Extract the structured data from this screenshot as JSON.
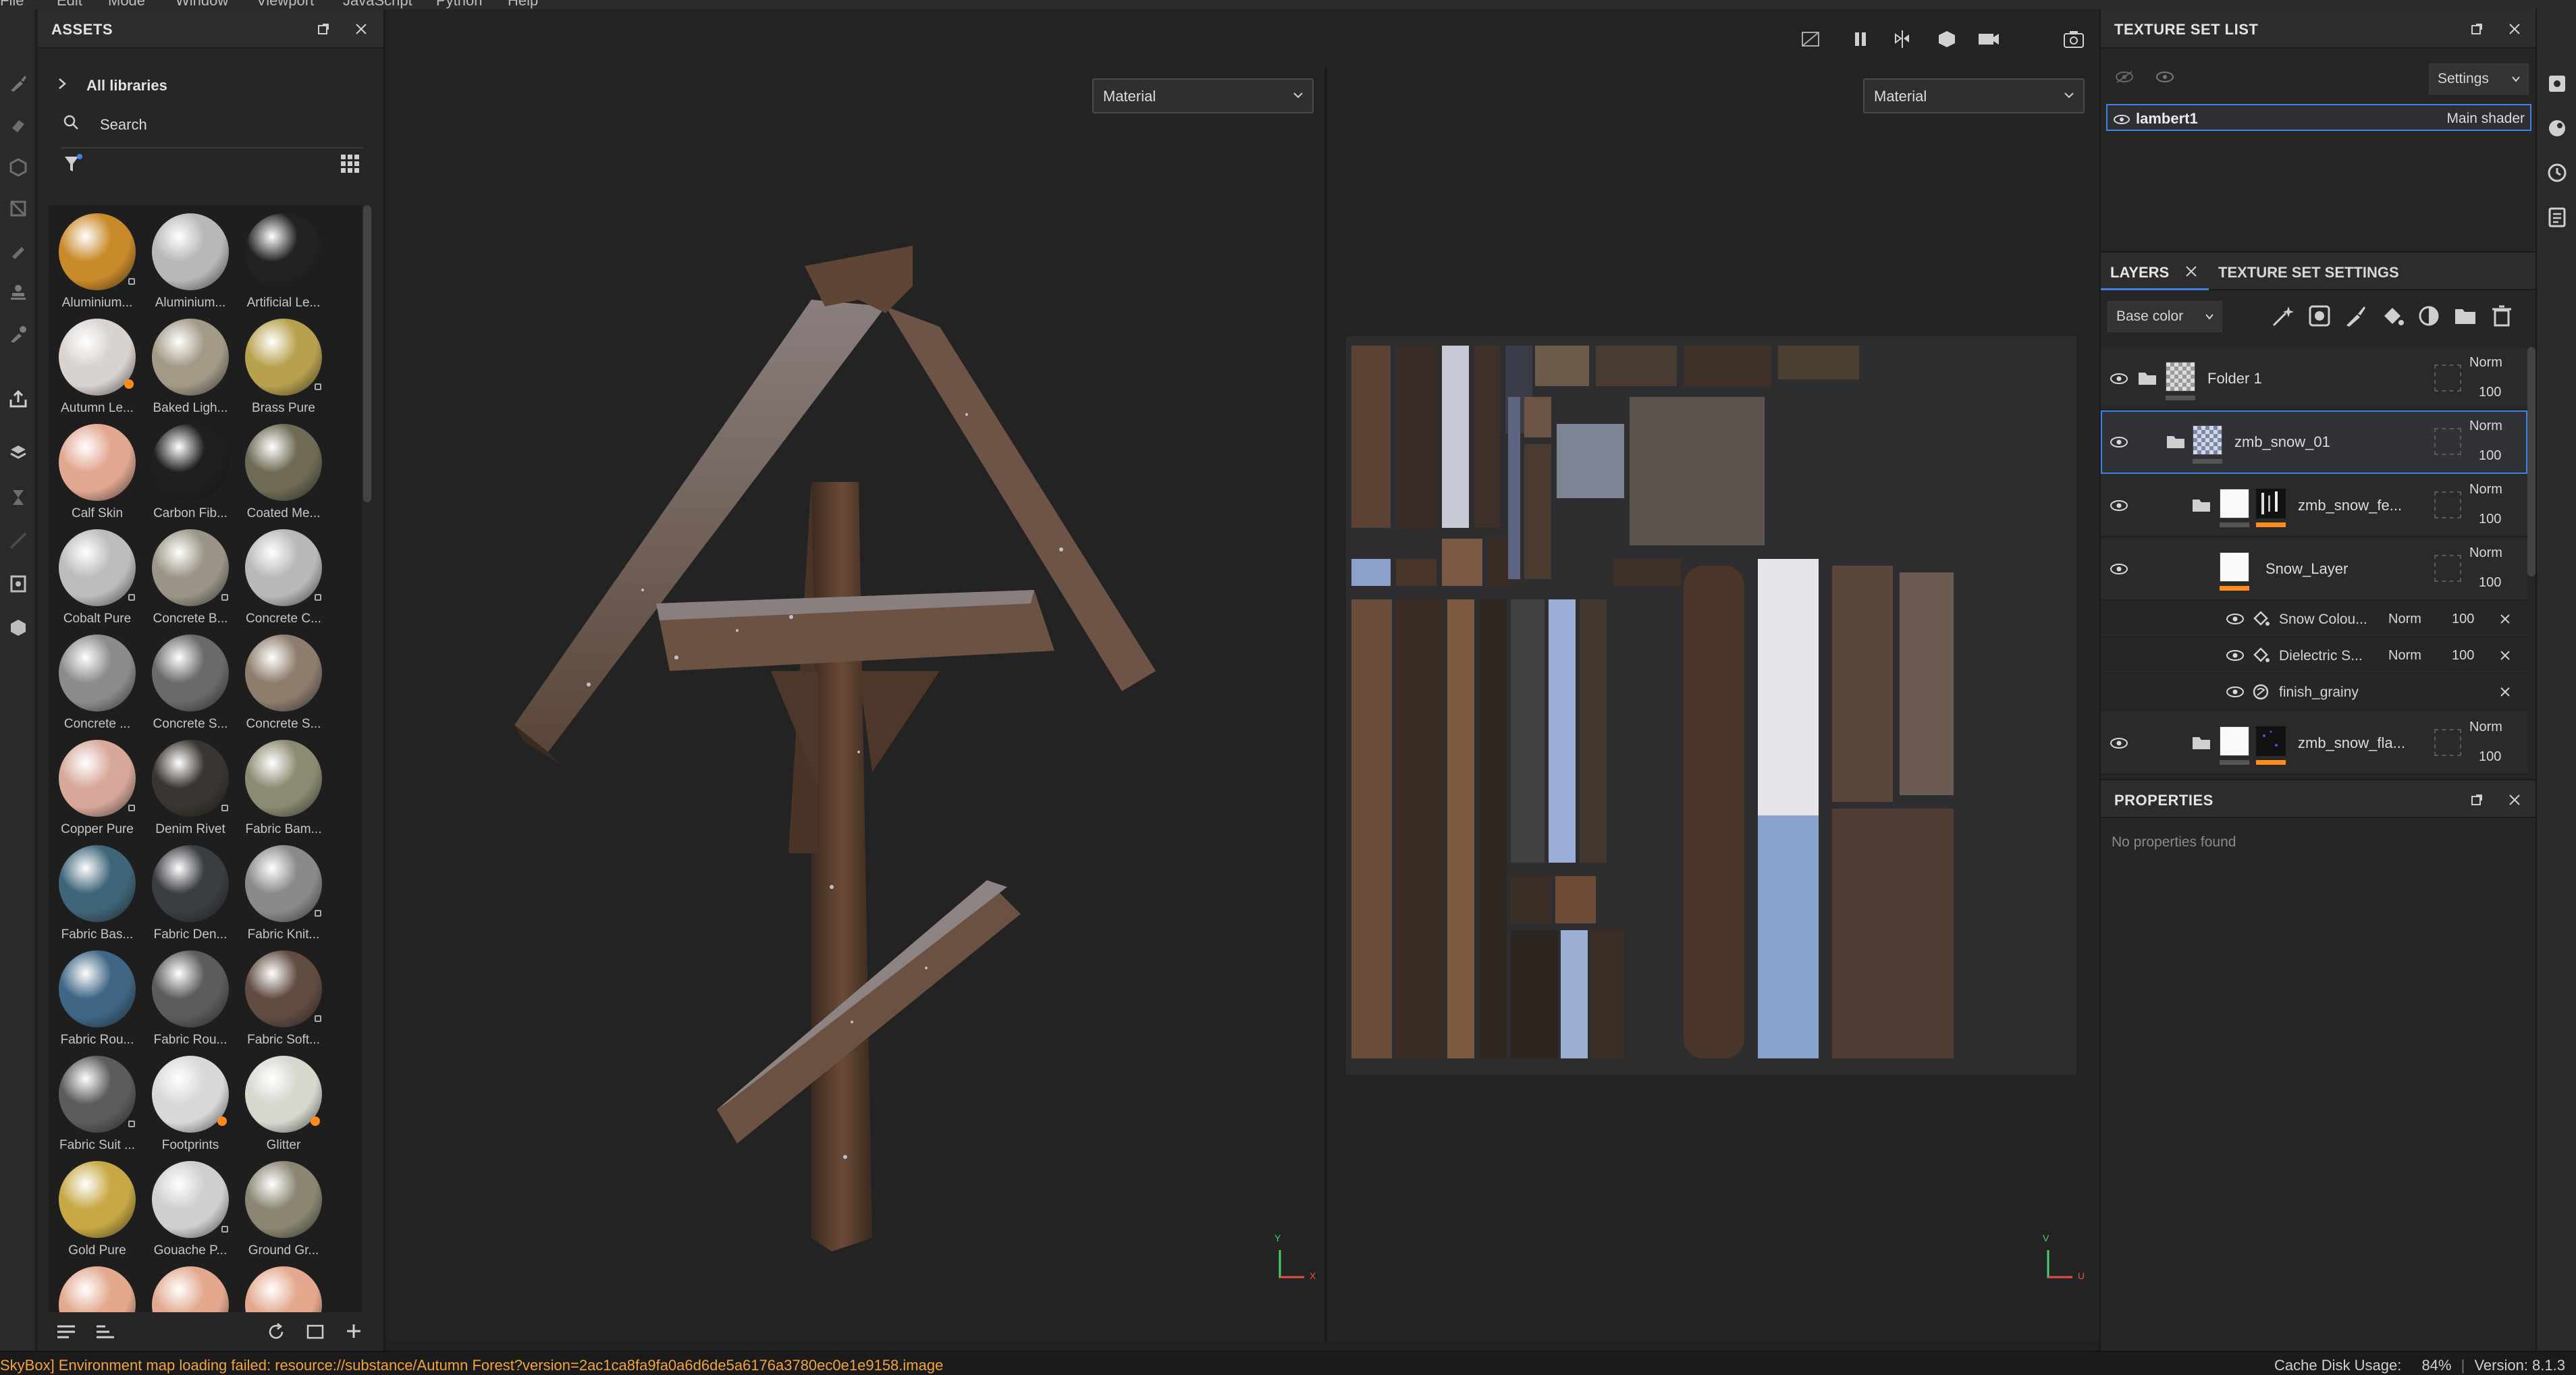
{
  "menu": {
    "items": [
      "File",
      "Edit",
      "Mode",
      "Window",
      "Viewport",
      "JavaScript",
      "Python",
      "Help"
    ]
  },
  "tools": {
    "icons": [
      "paint-brush-icon",
      "eraser-icon",
      "projection-icon",
      "geometry-mask-icon",
      "smudge-icon",
      "clone-stamp-icon",
      "color-picker-icon",
      "export-icon",
      "bake-icon",
      "hourglass-icon",
      "measure-icon",
      "viewer-icon",
      "shelf-icon"
    ]
  },
  "assets": {
    "title": "ASSETS",
    "libraries": "All libraries",
    "search_placeholder": "Search",
    "items": [
      {
        "label": "Aluminium...",
        "color": "#c98a2a"
      },
      {
        "label": "Aluminium...",
        "color": "#b8b8b8"
      },
      {
        "label": "Artificial Le...",
        "color": "#222222"
      },
      {
        "label": "Autumn Le...",
        "color": "#d9d3cf"
      },
      {
        "label": "Baked Ligh...",
        "color": "#a39987"
      },
      {
        "label": "Brass Pure",
        "color": "#b8a14e"
      },
      {
        "label": "Calf Skin",
        "color": "#e1a791"
      },
      {
        "label": "Carbon Fib...",
        "color": "#1f1f1f"
      },
      {
        "label": "Coated Me...",
        "color": "#6e6a54"
      },
      {
        "label": "Cobalt Pure",
        "color": "#bcbcbc"
      },
      {
        "label": "Concrete B...",
        "color": "#9b9587"
      },
      {
        "label": "Concrete C...",
        "color": "#b9b9b9"
      },
      {
        "label": "Concrete ...",
        "color": "#8c8c8c"
      },
      {
        "label": "Concrete S...",
        "color": "#6a6a6a"
      },
      {
        "label": "Concrete S...",
        "color": "#8e7d6c"
      },
      {
        "label": "Copper Pure",
        "color": "#d7a89a"
      },
      {
        "label": "Denim Rivet",
        "color": "#3a3530"
      },
      {
        "label": "Fabric Bam...",
        "color": "#8d8a72"
      },
      {
        "label": "Fabric Bas...",
        "color": "#3f6578"
      },
      {
        "label": "Fabric Den...",
        "color": "#3a3d42"
      },
      {
        "label": "Fabric Knit...",
        "color": "#8a8a8a"
      },
      {
        "label": "Fabric Rou...",
        "color": "#3f6684"
      },
      {
        "label": "Fabric Rou...",
        "color": "#5c5c5c"
      },
      {
        "label": "Fabric Soft...",
        "color": "#614c42"
      },
      {
        "label": "Fabric Suit ...",
        "color": "#5c5c5c"
      },
      {
        "label": "Footprints",
        "color": "#d8d8d8"
      },
      {
        "label": "Glitter",
        "color": "#d7d7cf"
      },
      {
        "label": "Gold Pure",
        "color": "#c7a845"
      },
      {
        "label": "Gouache P...",
        "color": "#cfcfcf"
      },
      {
        "label": "Ground Gr...",
        "color": "#8a8672"
      },
      {
        "label": "",
        "color": "#e3a88e"
      },
      {
        "label": "",
        "color": "#e3a88e"
      },
      {
        "label": "",
        "color": "#e3a88e"
      }
    ]
  },
  "viewport": {
    "left_mode": "Material",
    "right_mode": "Material"
  },
  "texture_set_list": {
    "title": "TEXTURE SET LIST",
    "settings_label": "Settings",
    "set_name": "lambert1",
    "shader": "Main shader"
  },
  "layers": {
    "tab_layers": "LAYERS",
    "tab_tss": "TEXTURE SET SETTINGS",
    "channel": "Base color",
    "rows": [
      {
        "name": "Folder 1",
        "blend": "Norm",
        "opacity": "100"
      },
      {
        "name": "zmb_snow_01",
        "blend": "Norm",
        "opacity": "100"
      },
      {
        "name": "zmb_snow_fe...",
        "blend": "Norm",
        "opacity": "100"
      },
      {
        "name": "Snow_Layer",
        "blend": "Norm",
        "opacity": "100"
      },
      {
        "name": "zmb_snow_fla...",
        "blend": "Norm",
        "opacity": "100"
      }
    ],
    "effects": [
      {
        "name": "Snow Colou...",
        "blend": "Norm",
        "opacity": "100"
      },
      {
        "name": "Dielectric S...",
        "blend": "Norm",
        "opacity": "100"
      },
      {
        "name": "finish_grainy"
      }
    ]
  },
  "properties": {
    "title": "PROPERTIES",
    "empty": "No properties found"
  },
  "gizmo": {
    "x": "X",
    "y": "Y",
    "u": "U",
    "v": "V"
  },
  "status": {
    "message": "SkyBox] Environment map loading failed: resource://substance/Autumn Forest?version=2ac1ca8fa9fa0a6d6de5a6176a3780ec0e1e9158.image",
    "cache": "Cache Disk Usage:",
    "cache_value": "84%",
    "version": "Version: 8.1.3"
  },
  "colors": {
    "accent": "#3f84e5",
    "warning": "#f2a33a",
    "orange": "#ff8a1e"
  }
}
